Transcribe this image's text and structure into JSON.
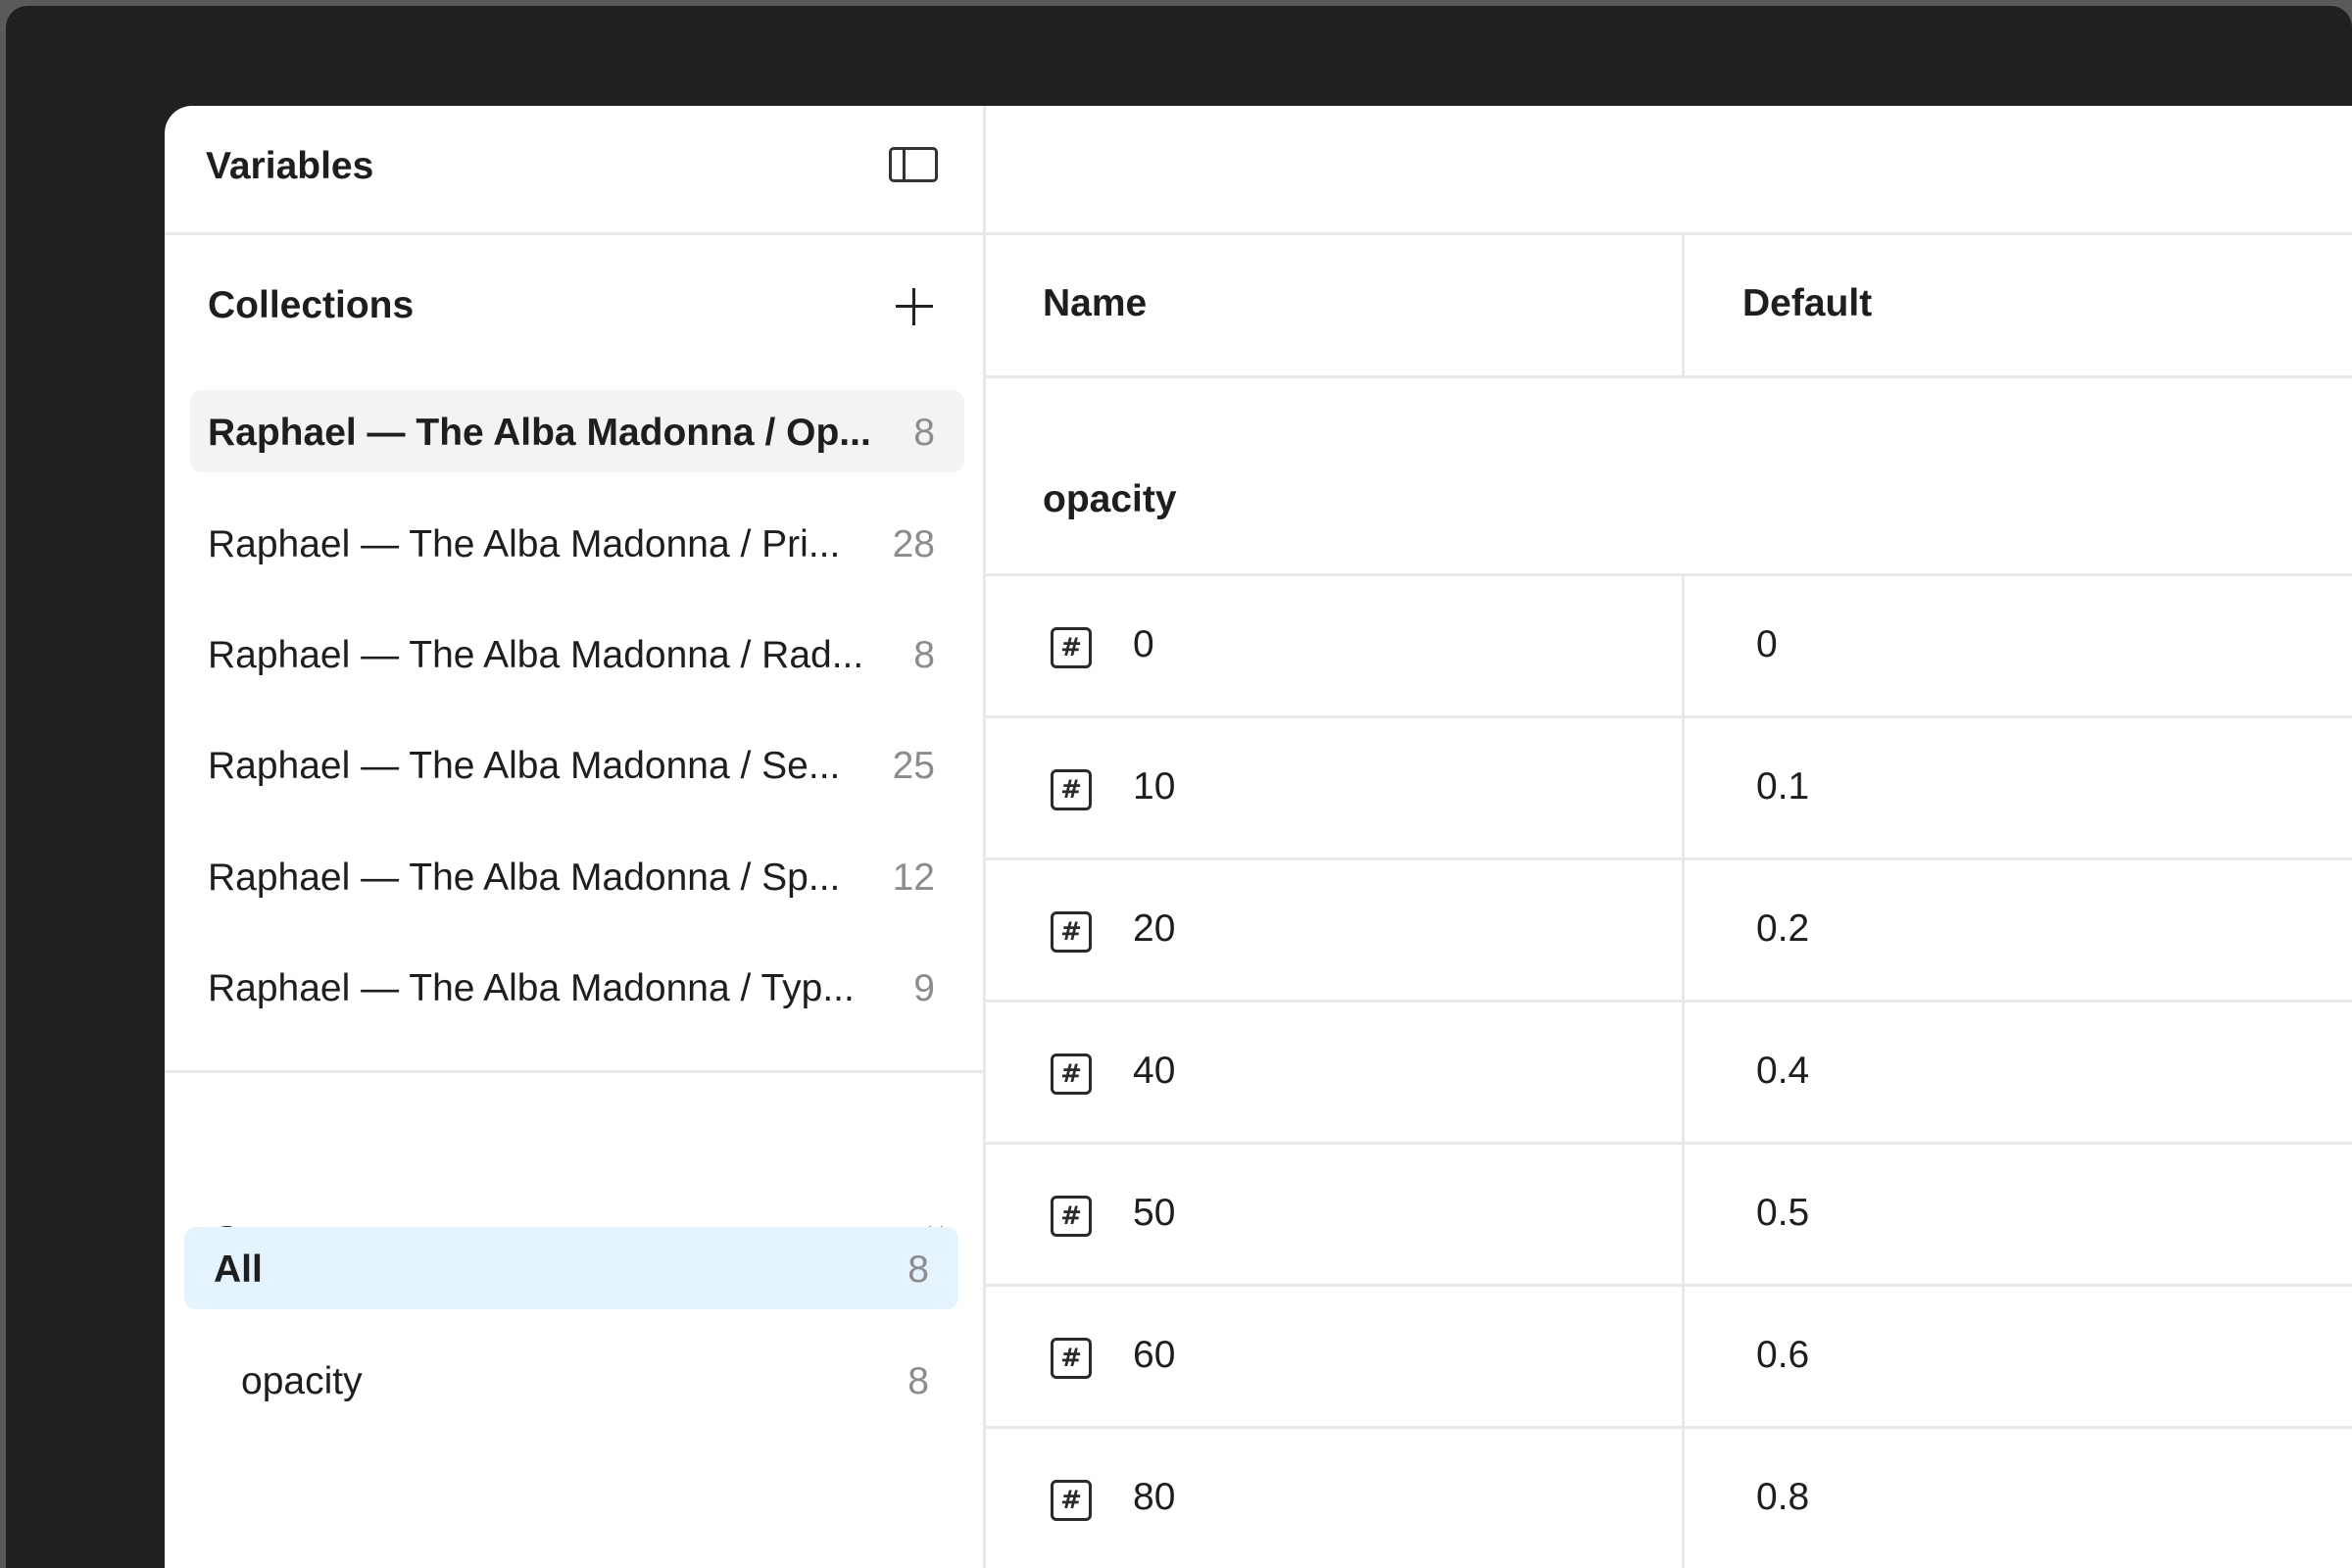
{
  "sidebar": {
    "title": "Variables",
    "collections": {
      "title": "Collections",
      "items": [
        {
          "label": "Raphael — The Alba Madonna / Op...",
          "count": "8"
        },
        {
          "label": "Raphael — The Alba Madonna / Pri...",
          "count": "28"
        },
        {
          "label": "Raphael — The Alba Madonna / Rad...",
          "count": "8"
        },
        {
          "label": "Raphael — The Alba Madonna / Se...",
          "count": "25"
        },
        {
          "label": "Raphael — The Alba Madonna / Sp...",
          "count": "12"
        },
        {
          "label": "Raphael — The Alba Madonna / Typ...",
          "count": "9"
        }
      ]
    },
    "groups": {
      "title": "Groups",
      "items": [
        {
          "label": "All",
          "count": "8"
        },
        {
          "label": "opacity",
          "count": "8"
        }
      ]
    }
  },
  "table": {
    "columns": {
      "name": "Name",
      "default": "Default"
    },
    "group_label": "opacity",
    "rows": [
      {
        "name": "0",
        "value": "0"
      },
      {
        "name": "10",
        "value": "0.1"
      },
      {
        "name": "20",
        "value": "0.2"
      },
      {
        "name": "40",
        "value": "0.4"
      },
      {
        "name": "50",
        "value": "0.5"
      },
      {
        "name": "60",
        "value": "0.6"
      },
      {
        "name": "80",
        "value": "0.8"
      }
    ]
  },
  "icons": {
    "panel_toggle": "sidebar-panel-icon",
    "add": "plus-icon",
    "groups_collapse": "collapse-list-icon",
    "variable_type": "number-hash-icon"
  },
  "colors": {
    "active_group_bg": "#e4f3fd",
    "active_collection_bg": "#f3f3f3",
    "frame_bg": "#202020"
  }
}
